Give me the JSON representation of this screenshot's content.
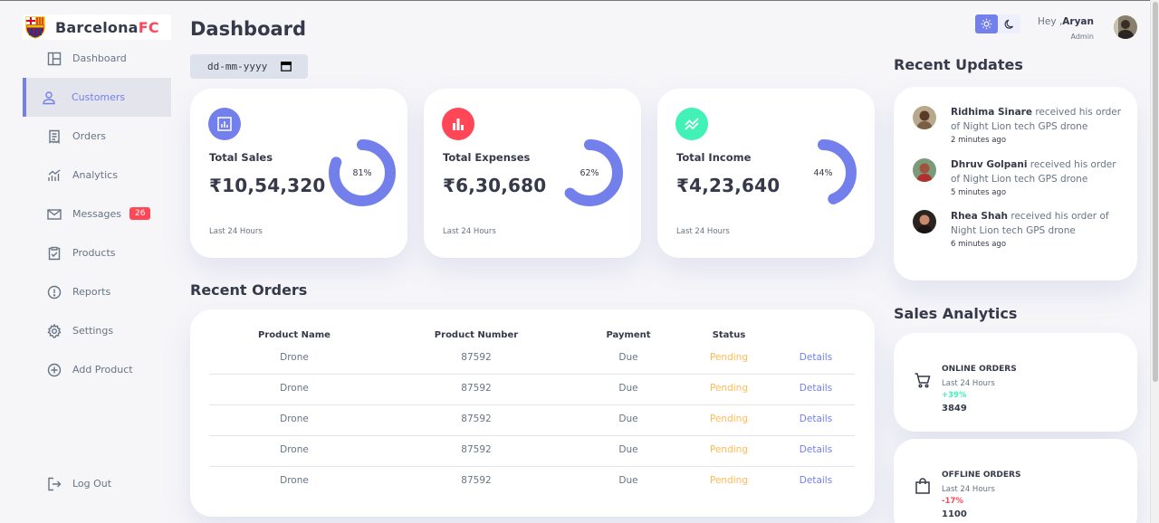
{
  "brand": {
    "name_main": "Barcelona",
    "name_accent": "FC",
    "accent_color": "#ff4757",
    "primary_color": "#7380ec"
  },
  "sidebar": {
    "items": [
      {
        "label": "Dashboard",
        "icon": "dashboard-icon"
      },
      {
        "label": "Customers",
        "icon": "person-icon",
        "active": true
      },
      {
        "label": "Orders",
        "icon": "receipt-icon"
      },
      {
        "label": "Analytics",
        "icon": "analytics-icon"
      },
      {
        "label": "Messages",
        "icon": "mail-icon",
        "badge": "26"
      },
      {
        "label": "Products",
        "icon": "inventory-icon"
      },
      {
        "label": "Reports",
        "icon": "report-icon"
      },
      {
        "label": "Settings",
        "icon": "gear-icon"
      },
      {
        "label": "Add Product",
        "icon": "add-circle-icon"
      }
    ],
    "logout": {
      "label": "Log Out",
      "icon": "logout-icon"
    }
  },
  "main": {
    "title": "Dashboard",
    "date_placeholder": "dd-mm-yyyy",
    "insights": [
      {
        "label": "Total Sales",
        "value": "₹10,54,320",
        "percent": 81,
        "percent_label": "81%",
        "footer": "Last 24 Hours",
        "icon": "bar-chart-icon",
        "color": "#7380ec"
      },
      {
        "label": "Total Expenses",
        "value": "₹6,30,680",
        "percent": 62,
        "percent_label": "62%",
        "footer": "Last 24 Hours",
        "icon": "bar-chart-icon",
        "color": "#ff4757"
      },
      {
        "label": "Total Income",
        "value": "₹4,23,640",
        "percent": 44,
        "percent_label": "44%",
        "footer": "Last 24 Hours",
        "icon": "stacked-line-chart-icon",
        "color": "#41f1b6"
      }
    ],
    "recent_orders": {
      "title": "Recent Orders",
      "headers": [
        "Product Name",
        "Product Number",
        "Payment",
        "Status",
        ""
      ],
      "rows": [
        [
          "Drone",
          "87592",
          "Due",
          "Pending",
          "Details"
        ],
        [
          "Drone",
          "87592",
          "Due",
          "Pending",
          "Details"
        ],
        [
          "Drone",
          "87592",
          "Due",
          "Pending",
          "Details"
        ],
        [
          "Drone",
          "87592",
          "Due",
          "Pending",
          "Details"
        ],
        [
          "Drone",
          "87592",
          "Due",
          "Pending",
          "Details"
        ]
      ]
    }
  },
  "topbar": {
    "greeting": "Hey ,",
    "user_name": "Aryan",
    "role": "Admin",
    "theme_icons": [
      "sun-icon",
      "moon-icon"
    ]
  },
  "recent_updates": {
    "title": "Recent Updates",
    "items": [
      {
        "name": "Ridhima Sinare",
        "text": " received his order of Night Lion tech GPS drone",
        "time": "2 minutes ago"
      },
      {
        "name": "Dhruv Golpani",
        "text": " received his order of Night Lion tech GPS drone",
        "time": "5 minutes ago"
      },
      {
        "name": "Rhea Shah",
        "text": " received his order of Night Lion tech GPS drone",
        "time": "6 minutes ago"
      }
    ]
  },
  "sales_analytics": {
    "title": "Sales Analytics",
    "items": [
      {
        "title": "ONLINE ORDERS",
        "sub": "Last 24 Hours",
        "delta": "+39%",
        "count": "3849",
        "icon": "shopping-cart-icon",
        "delta_color": "#41f1b6"
      },
      {
        "title": "OFFLINE ORDERS",
        "sub": "Last 24 Hours",
        "delta": "-17%",
        "count": "1100",
        "icon": "shopping-bag-icon",
        "delta_color": "#ff4757"
      }
    ]
  }
}
